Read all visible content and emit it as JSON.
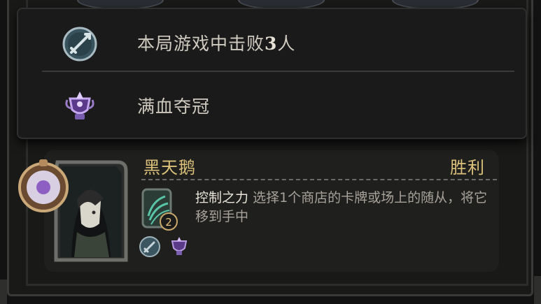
{
  "tooltip": {
    "rows": [
      {
        "icon": "crossed-swords-icon",
        "text_prefix": "本局游戏中击败",
        "count": "3",
        "text_suffix": "人"
      },
      {
        "icon": "purple-trophy-icon",
        "text": "满血夺冠"
      }
    ]
  },
  "player": {
    "name": "黑天鹅",
    "result": "胜利",
    "skill_level": "2",
    "ability_title": "控制之力",
    "ability_desc": "选择1个商店的卡牌或场上的随从，将它移到手中",
    "badges": [
      "crossed-swords-icon",
      "purple-trophy-icon"
    ]
  },
  "colors": {
    "gold_text": "#dcc17a",
    "body_text": "#d0cbc0",
    "desc_text": "#a8a39a",
    "panel_bg": "#1a1a1a"
  }
}
